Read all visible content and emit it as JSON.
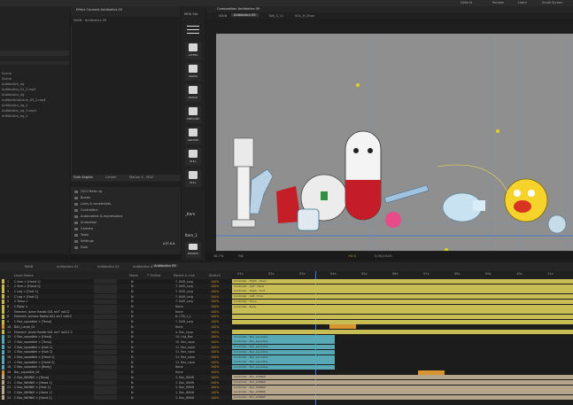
{
  "topbar": {
    "workspaces": [
      "Default",
      "Review",
      "Learn",
      "Small Screen"
    ]
  },
  "project_panel": {
    "items": [
      "Scene",
      "Scene",
      "Antibiotics_rig",
      "Antibiotics_01_2.mp4",
      "Antibiotics_rig",
      "AntibioticsScene_03_2.mp4",
      "Antibiotics_rig_2",
      "Antibiotics_rig_3.mp4",
      "Antibiotics_rig_2"
    ]
  },
  "effect_controls": {
    "tab_label": "Effect Controls Antibiotics 09",
    "subtitle": "MAIN · Antibiotics 09"
  },
  "duik": {
    "tabs": [
      "Duik Angela",
      "Limber",
      "Motion 4 - MGII"
    ],
    "items": [
      "OCO Meta rig",
      "Bones",
      "Links & constraints",
      "Controllers",
      "Automation & expressions",
      "Animation",
      "Camera",
      "Tools",
      "Settings",
      "Duik"
    ],
    "version": "v17.0.4"
  },
  "toolbar": {
    "title": "MOS Set",
    "buttons": [
      "LAYERS",
      "ORDER",
      "NUDGE",
      "PRECOMP",
      "ANCHOR",
      "NULL",
      "NULL",
      "_Item",
      "Item_1",
      "BOUNCE"
    ]
  },
  "composition": {
    "tab_label": "Composition Antibiotics 09",
    "subtabs": [
      "MAIN",
      "Antibiotics 09",
      "TAB_3_11",
      "SOL_R_Shoe"
    ],
    "footer": {
      "zoom": "38.7%",
      "resolution": "Full",
      "timecode": "0;00;03;00",
      "exposure": "+0.0"
    },
    "canvas_bg": "#8f8f8f"
  },
  "timeline": {
    "tabs": [
      "MAIN",
      "Antibiotics 02",
      "Antibiotics 02",
      "Antibiotics 02",
      "Antibiotics 09"
    ],
    "columns": {
      "layer_name": "Layer Name",
      "mode": "Mode",
      "trkmat": "T TrkMat",
      "parent": "Parent & Link",
      "stretch": "Stretch"
    },
    "layers": [
      {
        "num": "1",
        "name": "C Arm > [Hand 1]",
        "mode": "N",
        "parent": "7. BAR_Larg",
        "stretch": "100%",
        "label": "#c9b84a",
        "bar": "#c8bc54",
        "bar_start": 0,
        "bar_end": 385,
        "caption": "Controller - Right - Hand"
      },
      {
        "num": "2",
        "name": "C Arm > [Hand 2]",
        "mode": "N",
        "parent": "7. BAR_Larg",
        "stretch": "100%",
        "label": "#c9b84a",
        "bar": "#c8bc54",
        "bar_start": 0,
        "bar_end": 385,
        "caption": "Controller - Left - Hand"
      },
      {
        "num": "3",
        "name": "C Leg > [Foot 1]",
        "mode": "N",
        "parent": "7. BAR_Larg",
        "stretch": "100%",
        "label": "#c9b84a",
        "bar": "#c8bc54",
        "bar_start": 0,
        "bar_end": 385,
        "caption": "Controller - Right - Foot"
      },
      {
        "num": "4",
        "name": "C Leg > [Foot 2]",
        "mode": "N",
        "parent": "7. BAR_Larg",
        "stretch": "100%",
        "label": "#c9b84a",
        "bar": "#c8bc54",
        "bar_start": 0,
        "bar_end": 385,
        "caption": "Controller - Left - Foot"
      },
      {
        "num": "5",
        "name": "C Torso >",
        "mode": "N",
        "parent": "7. BAR_Larg",
        "stretch": "100%",
        "label": "#c9b84a",
        "bar": "#c8bc54",
        "bar_start": 0,
        "bar_end": 385,
        "caption": "Controller - Torso"
      },
      {
        "num": "6",
        "name": "C Body >",
        "mode": "N",
        "parent": "None",
        "stretch": "100%",
        "label": "#c9b84a",
        "bar": "#c8bc54",
        "bar_start": 0,
        "bar_end": 385,
        "caption": "Controller - Body"
      },
      {
        "num": "7",
        "name": "Element: Joiner Radial 001 recT ro012",
        "mode": "N",
        "parent": "None",
        "stretch": "100%",
        "label": "#c9b84a",
        "bar": "#c8bc54",
        "bar_start": 0,
        "bar_end": 385,
        "caption": ""
      },
      {
        "num": "8",
        "name": "Element: pinions Radial 001 recT ro012",
        "mode": "N",
        "parent": "6. CTB_1_L",
        "stretch": "100%",
        "label": "#c9b84a",
        "bar": "#c8bc54",
        "bar_start": 0,
        "bar_end": 385,
        "caption": ""
      },
      {
        "num": "9",
        "name": "C Bac_squadble > [Torso]",
        "mode": "N",
        "parent": "7. BAR_Larg",
        "stretch": "100%",
        "label": "#c9b84a",
        "bar": "#c8bc54",
        "bar_start": 0,
        "bar_end": 385,
        "caption": ""
      },
      {
        "num": "10",
        "name": "BAC_Large_01",
        "mode": "N",
        "parent": "None",
        "stretch": "100%",
        "label": "#d68f2e",
        "bar": "#d7952f",
        "bar_start": 110,
        "bar_end": 140,
        "caption": ""
      },
      {
        "num": "11",
        "name": "Element: Joiner Radial 001 recT ro012 2",
        "mode": "N",
        "parent": "4. Bac_squa",
        "stretch": "100%",
        "label": "#c9b84a",
        "bar": "#c8bc54",
        "bar_start": 0,
        "bar_end": 385,
        "caption": ""
      },
      {
        "num": "12",
        "name": "C Bac_squadble > [Head]",
        "mode": "N",
        "parent": "14. Leg_Bac",
        "stretch": "100%",
        "label": "#54a7b5",
        "bar": "#57a9b5",
        "bar_start": 0,
        "bar_end": 116,
        "caption": "Controller - Bac_squadble"
      },
      {
        "num": "13",
        "name": "C Bac_squadble > [Torso]",
        "mode": "N",
        "parent": "10. Bac_squa",
        "stretch": "100%",
        "label": "#54a7b5",
        "bar": "#57a9b5",
        "bar_start": 0,
        "bar_end": 116,
        "caption": "Controller - Bac_squadble"
      },
      {
        "num": "14",
        "name": "C Bac_squadble > [foot 1]",
        "mode": "N",
        "parent": "11. Bac_squa",
        "stretch": "100%",
        "label": "#54a7b5",
        "bar": "#57a9b5",
        "bar_start": 0,
        "bar_end": 116,
        "caption": "Controller - Bac_squadble"
      },
      {
        "num": "15",
        "name": "C Bac_squadble > [foot 2]",
        "mode": "N",
        "parent": "11. Bac_squa",
        "stretch": "100%",
        "label": "#54a7b5",
        "bar": "#57a9b5",
        "bar_start": 0,
        "bar_end": 116,
        "caption": "Controller - Bac_squadble"
      },
      {
        "num": "16",
        "name": "C Bac_squadble > [Hand 1]",
        "mode": "N",
        "parent": "11. Bac_squa",
        "stretch": "100%",
        "label": "#54a7b5",
        "bar": "#57a9b5",
        "bar_start": 0,
        "bar_end": 116,
        "caption": "Controller - Bac_squadble"
      },
      {
        "num": "17",
        "name": "C Bac_squadble > [Hand 2]",
        "mode": "N",
        "parent": "11. Bac_squa",
        "stretch": "100%",
        "label": "#54a7b5",
        "bar": "#57a9b5",
        "bar_start": 0,
        "bar_end": 116,
        "caption": "Controller - Bac_squadble"
      },
      {
        "num": "18",
        "name": "C Bac_squadble > [Body]",
        "mode": "N",
        "parent": "None",
        "stretch": "100%",
        "label": "#54a7b5",
        "bar": "#57a9b5",
        "bar_start": 0,
        "bar_end": 116,
        "caption": "Controller - Bac_squadble"
      },
      {
        "num": "19",
        "name": "Bac_squadble_02",
        "mode": "N",
        "parent": "None",
        "stretch": "100%",
        "label": "#d68f2e",
        "bar": "#d7952f",
        "bar_start": 210,
        "bar_end": 240,
        "caption": ""
      },
      {
        "num": "20",
        "name": "C Bac_WINNIE > [Torso]",
        "mode": "N",
        "parent": "1. Bac_WINN",
        "stretch": "100%",
        "label": "#b8a98a",
        "bar": "#b5a68b",
        "bar_start": 0,
        "bar_end": 385,
        "caption": "Controller - Bac_WINNIE"
      },
      {
        "num": "21",
        "name": "C Bac_WINNIE > [Head 1]",
        "mode": "N",
        "parent": "1. Bac_WINN",
        "stretch": "100%",
        "label": "#b8a98a",
        "bar": "#b5a68b",
        "bar_start": 0,
        "bar_end": 385,
        "caption": "Controller - Bac_WINNIE"
      },
      {
        "num": "22",
        "name": "C Bac_WINNIE > [Foot 1]",
        "mode": "N",
        "parent": "1. Bac_WINN",
        "stretch": "100%",
        "label": "#b8a98a",
        "bar": "#b5a68b",
        "bar_start": 0,
        "bar_end": 385,
        "caption": "Controller - Bac_WINNIE"
      },
      {
        "num": "23",
        "name": "C Bac_WINNIE > [Hand 1]",
        "mode": "N",
        "parent": "1. Bac_WINN",
        "stretch": "100%",
        "label": "#b8a98a",
        "bar": "#b5a68b",
        "bar_start": 0,
        "bar_end": 385,
        "caption": "Controller - Bac_WINNIE"
      },
      {
        "num": "24",
        "name": "C Bac_WINNIE > [Hand 2]",
        "mode": "N",
        "parent": "1. Bac_WINN",
        "stretch": "100%",
        "label": "#b8a98a",
        "bar": "#b5a68b",
        "bar_start": 0,
        "bar_end": 385,
        "caption": "Controller - Bac_WINNIE"
      }
    ],
    "ruler_ticks": [
      "01s",
      "02s",
      "03s",
      "04s",
      "05s",
      "06s",
      "07s",
      "08s",
      "09s",
      "10s",
      "11s"
    ]
  }
}
